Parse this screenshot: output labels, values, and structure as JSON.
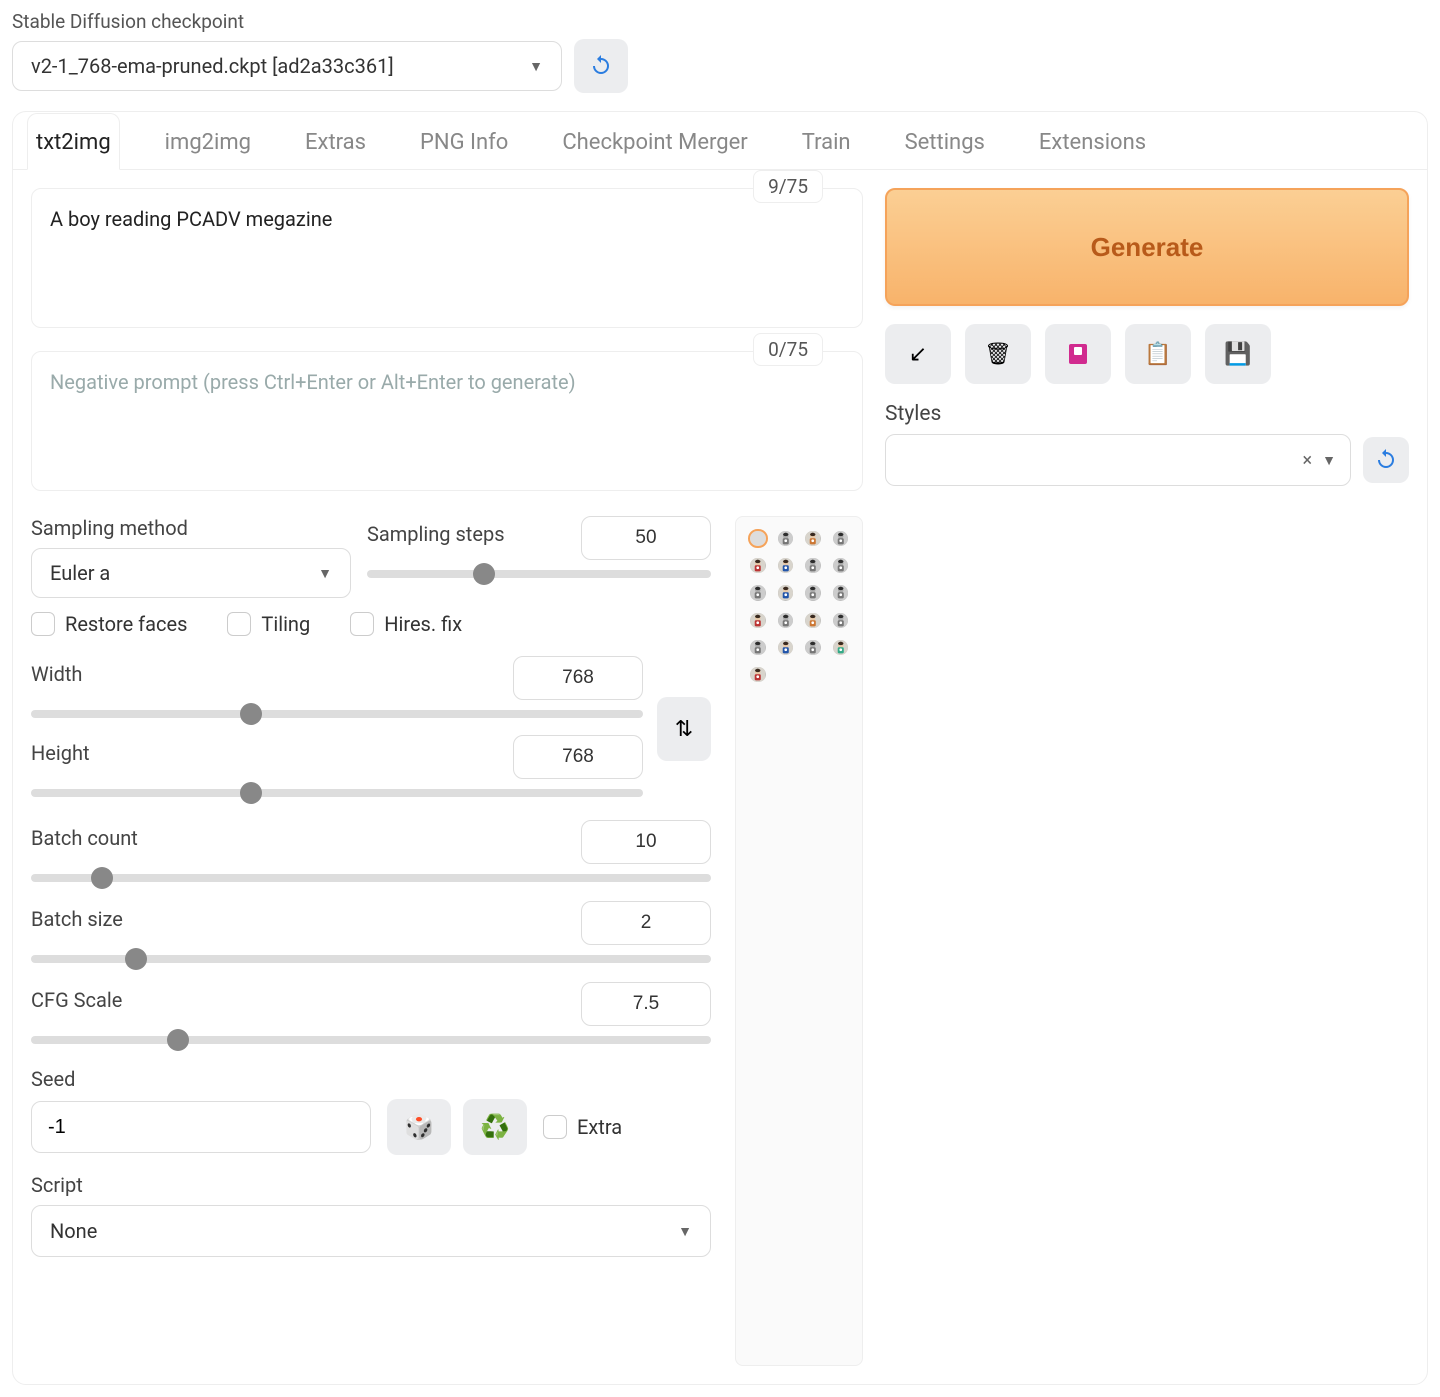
{
  "checkpoint": {
    "label": "Stable Diffusion checkpoint",
    "value": "v2-1_768-ema-pruned.ckpt [ad2a33c361]"
  },
  "tabs": [
    "txt2img",
    "img2img",
    "Extras",
    "PNG Info",
    "Checkpoint Merger",
    "Train",
    "Settings",
    "Extensions"
  ],
  "active_tab": "txt2img",
  "prompt": {
    "value": "A boy reading PCADV megazine",
    "tokens": "9/75"
  },
  "neg_prompt": {
    "placeholder": "Negative prompt (press Ctrl+Enter or Alt+Enter to generate)",
    "tokens": "0/75"
  },
  "generate_label": "Generate",
  "styles": {
    "label": "Styles",
    "clear": "×"
  },
  "sampling_method": {
    "label": "Sampling method",
    "value": "Euler a"
  },
  "sampling_steps": {
    "label": "Sampling steps",
    "value": "50",
    "min": 1,
    "max": 150
  },
  "checkboxes": {
    "restore_faces": "Restore faces",
    "tiling": "Tiling",
    "hires_fix": "Hires. fix"
  },
  "width": {
    "label": "Width",
    "value": "768",
    "min": 64,
    "max": 2048
  },
  "height": {
    "label": "Height",
    "value": "768",
    "min": 64,
    "max": 2048
  },
  "batch_count": {
    "label": "Batch count",
    "value": "10",
    "min": 1,
    "max": 100
  },
  "batch_size": {
    "label": "Batch size",
    "value": "2",
    "min": 1,
    "max": 8
  },
  "cfg_scale": {
    "label": "CFG Scale",
    "value": "7.5",
    "min": 1,
    "max": 30
  },
  "seed": {
    "label": "Seed",
    "value": "-1",
    "extra_label": "Extra"
  },
  "script": {
    "label": "Script",
    "value": "None"
  },
  "tool_icons": [
    "arrow",
    "trash",
    "card",
    "clipboard",
    "save"
  ],
  "gallery_count": 21
}
